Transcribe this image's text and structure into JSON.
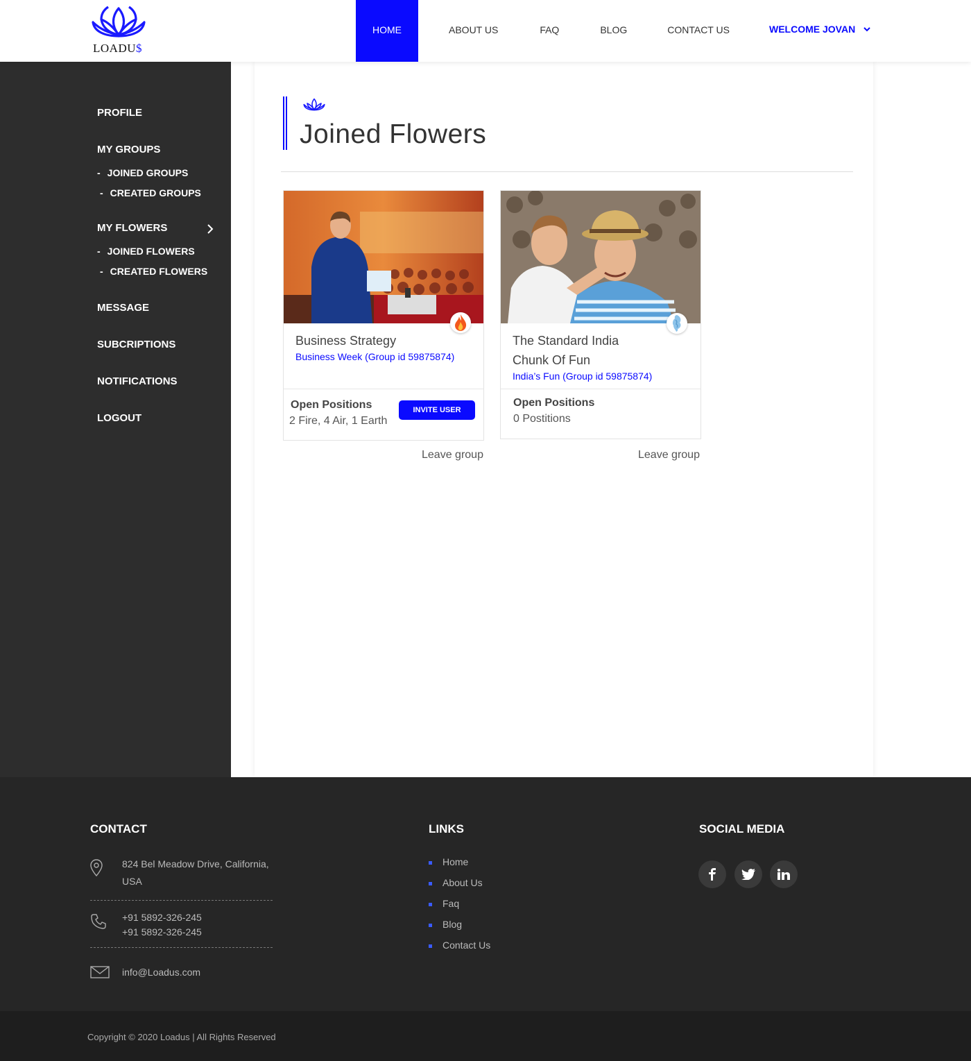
{
  "header": {
    "logo_text_main": "LOADU",
    "logo_text_accent": "$",
    "nav": [
      "HOME",
      "ABOUT US",
      "FAQ",
      "BLOG",
      "CONTACT US"
    ],
    "active_index": 0,
    "welcome": "WELCOME JOVAN"
  },
  "sidebar": {
    "profile": "PROFILE",
    "my_groups": "MY GROUPS",
    "joined_groups": "JOINED GROUPS",
    "created_groups": "CREATED GROUPS",
    "my_flowers": "MY FLOWERS",
    "joined_flowers": "JOINED FLOWERS",
    "created_flowers": "CREATED FLOWERS",
    "message": "MESSAGE",
    "subscriptions": "SUBCRIPTIONS",
    "notifications": "NOTIFICATIONS",
    "logout": "LOGOUT"
  },
  "main": {
    "title": "Joined Flowers",
    "cards": [
      {
        "title": "Business Strategy",
        "subtitle": "Business Week (Group id 59875874)",
        "open_label": "Open Positions",
        "open_value": "2 Fire, 4 Air, 1  Earth",
        "invite_label": "INVITE USER",
        "leave": "Leave group",
        "badge_icon": "fire-icon"
      },
      {
        "title_line1": "The Standard India",
        "title_line2": "Chunk Of Fun",
        "subtitle": "India’s Fun (Group id 59875874)",
        "open_label": "Open Positions",
        "open_value": "0 Postitions",
        "leave": "Leave group",
        "badge_icon": "air-icon"
      }
    ]
  },
  "footer": {
    "contact_heading": "CONTACT",
    "address_line1": "824 Bel Meadow Drive, California,",
    "address_line2": "USA",
    "phone1": "+91 5892-326-245",
    "phone2": "+91 5892-326-245",
    "email": "info@Loadus.com",
    "links_heading": "LINKS",
    "links": [
      "Home",
      "About Us",
      "Faq",
      "Blog",
      "Contact Us"
    ],
    "social_heading": "SOCIAL MEDIA",
    "social_icons": [
      "facebook-icon",
      "twitter-icon",
      "linkedin-icon"
    ],
    "copyright": "Copyright © 2020 Loadus | All Rights Reserved"
  },
  "colors": {
    "accent": "#0a0aff",
    "sidebar_bg": "#2d2d2d",
    "footer_bg": "#262626",
    "copyright_bg": "#1e1e1e"
  }
}
